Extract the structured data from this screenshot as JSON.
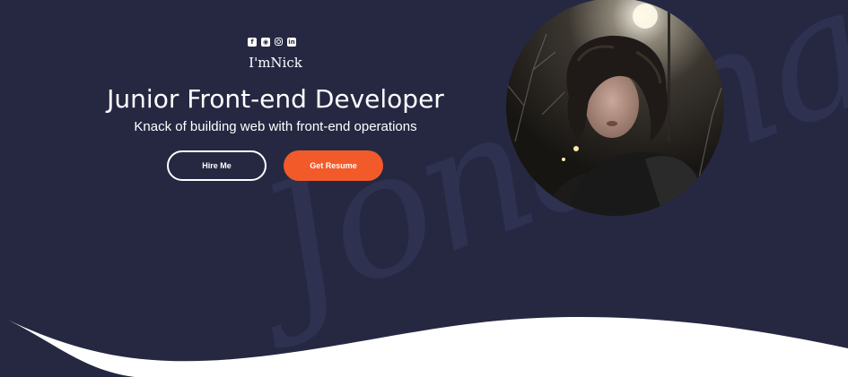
{
  "social": {
    "icons": [
      "facebook-icon",
      "github-icon",
      "instagram-icon",
      "linkedin-icon"
    ],
    "facebook_glyph": "f",
    "github_glyph": "◉",
    "linkedin_glyph": "in"
  },
  "hero": {
    "greeting": "I'mNick",
    "title": "Junior Front-end Developer",
    "subtitle": "Knack of building web with front-end operations",
    "background_script": "Jonathan"
  },
  "buttons": {
    "hire_label": "Hire Me",
    "resume_label": "Get Resume"
  },
  "colors": {
    "background": "#262842",
    "accent": "#f25a29",
    "text": "#ffffff",
    "wave": "#ffffff"
  }
}
